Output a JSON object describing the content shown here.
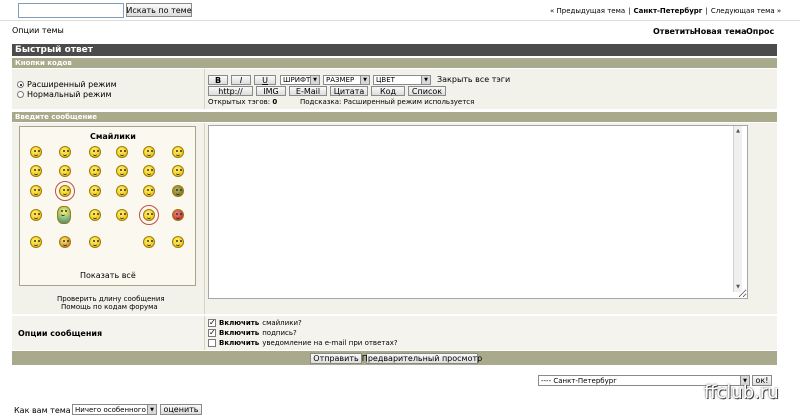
{
  "top": {
    "search_value": "",
    "search_button": "Искать по теме",
    "prev_topic": "« Предыдущая тема",
    "current_forum": "Санкт-Петербург",
    "next_topic": "Следующая тема »",
    "sep": "|"
  },
  "options": {
    "topic_options": "Опции темы",
    "actions": [
      "Ответить",
      "Новая тема",
      "Опрос"
    ]
  },
  "quick_reply": {
    "title": "Быстрый ответ",
    "codes_header": "Кнопки кодов",
    "modes": [
      {
        "label": "Расширенный режим",
        "selected": true
      },
      {
        "label": "Нормальный режим",
        "selected": false
      }
    ],
    "format_buttons": [
      "B",
      "I",
      "U"
    ],
    "selects": {
      "font": "ШРИФТ",
      "size": "РАЗМЕР",
      "color": "ЦВЕТ"
    },
    "close_all_tags": "Закрыть все тэги",
    "row2_buttons": [
      "http://",
      "IMG",
      "E-Mail",
      "Цитата",
      "Код",
      "Список"
    ],
    "open_tags_label": "Открытых тэгов:",
    "open_tags_count": "0",
    "hint": "Подсказка: Расширенный режим используется",
    "message_header": "Введите сообщение",
    "smilies_title": "Смайлики",
    "show_all": "Показать всё",
    "check_length": "Проверить длину сообщения",
    "help_codes": "Помощь по кодам форума",
    "message_value": ""
  },
  "message_options": {
    "label": "Опции сообщения",
    "checks": [
      {
        "bold": "Включить",
        "rest": "смайлики?",
        "checked": true
      },
      {
        "bold": "Включить",
        "rest": "подпись?",
        "checked": true
      },
      {
        "bold": "Включить",
        "rest": "уведомление на e-mail при ответах?",
        "checked": false
      }
    ]
  },
  "submit": {
    "send": "Отправить",
    "preview": "Предварительный просмотр"
  },
  "footer": {
    "forum_select": "---- Санкт-Петербург",
    "go_button": "ок!",
    "rate_label": "Как вам тема ?",
    "rate_select": "Ничего особенного",
    "rate_button": "оценить",
    "watermark": "ffclub.ru"
  }
}
